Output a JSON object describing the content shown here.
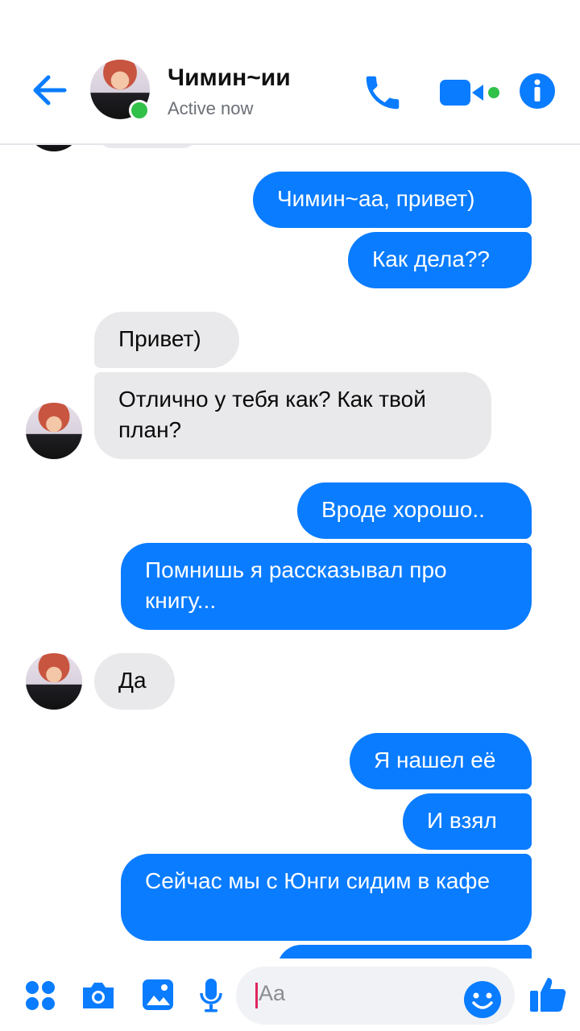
{
  "header": {
    "contact_name": "Чимин~ии",
    "status": "Active now"
  },
  "messages": [
    {
      "side": "out",
      "text": "Чимин~аа, привет)"
    },
    {
      "side": "out",
      "text": "Как дела??"
    },
    {
      "side": "in",
      "text": "Привет)"
    },
    {
      "side": "in",
      "text": "Отлично у тебя как? Как твой план?"
    },
    {
      "side": "out",
      "text": "Вроде хорошо.."
    },
    {
      "side": "out",
      "text": "Помнишь я рассказывал про книгу..."
    },
    {
      "side": "in",
      "text": "Да"
    },
    {
      "side": "out",
      "text": "Я нашел её"
    },
    {
      "side": "out",
      "text": "И взял"
    },
    {
      "side": "out",
      "text": "Сейчас мы с Юнги сидим в кафе"
    }
  ],
  "composer": {
    "placeholder": "Aa",
    "icons": [
      "apps-icon",
      "camera-icon",
      "gallery-icon",
      "microphone-icon",
      "emoji-icon",
      "thumbs-up-icon"
    ]
  },
  "colors": {
    "accent": "#0a7cff",
    "incoming_bubble": "#e9e9eb",
    "online": "#31c048"
  }
}
